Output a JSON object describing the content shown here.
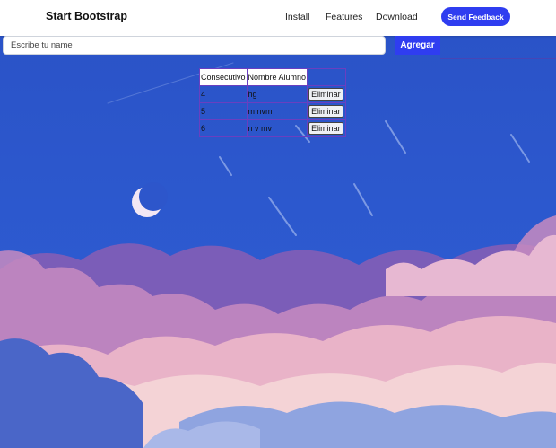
{
  "navbar": {
    "brand": "Start Bootstrap",
    "links": [
      "Install",
      "Features",
      "Download"
    ],
    "feedback_label": "Send Feedback"
  },
  "form": {
    "placeholder": "Escribe tu name",
    "value": "",
    "add_label": "Agregar"
  },
  "table": {
    "headers": [
      "Consecutivo",
      "Nombre Alumno",
      ""
    ],
    "rows": [
      {
        "id": "4",
        "name": "hg",
        "action": "Eliminar"
      },
      {
        "id": "5",
        "name": "m nvm",
        "action": "Eliminar"
      },
      {
        "id": "6",
        "name": "n v mv",
        "action": "Eliminar"
      }
    ]
  },
  "colors": {
    "accent": "#2f3df0",
    "sky": "#2b57c8",
    "clouds_pink": "#d99ac0",
    "clouds_purple": "#7b5db8"
  },
  "icons": [
    "crescent-moon-icon"
  ]
}
